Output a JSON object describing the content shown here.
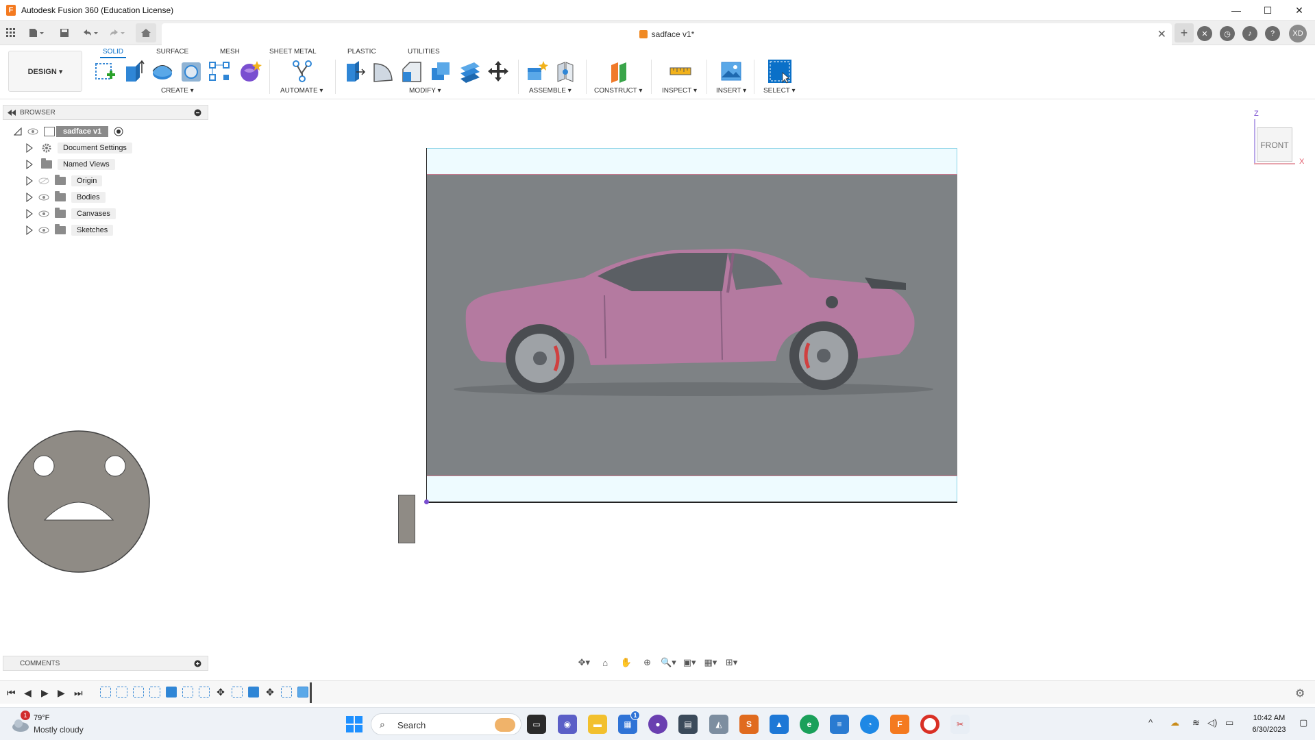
{
  "window": {
    "title": "Autodesk Fusion 360 (Education License)",
    "minimize": "—",
    "maximize": "☐",
    "close": "✕"
  },
  "document": {
    "tab_title": "sadface v1*",
    "close": "✕"
  },
  "user": {
    "initials": "XD"
  },
  "ribbon": {
    "workspace": "DESIGN ▾",
    "tabs": [
      "SOLID",
      "SURFACE",
      "MESH",
      "SHEET METAL",
      "PLASTIC",
      "UTILITIES"
    ],
    "groups": {
      "create": "CREATE ▾",
      "automate": "AUTOMATE ▾",
      "modify": "MODIFY ▾",
      "assemble": "ASSEMBLE ▾",
      "construct": "CONSTRUCT ▾",
      "inspect": "INSPECT ▾",
      "insert": "INSERT ▾",
      "select": "SELECT ▾"
    }
  },
  "browser": {
    "header": "BROWSER",
    "root": "sadface v1",
    "items": [
      {
        "label": "Document Settings",
        "icon": "gear-icon"
      },
      {
        "label": "Named Views",
        "icon": "folder-icon"
      },
      {
        "label": "Origin",
        "icon": "folder-icon",
        "hidden": true
      },
      {
        "label": "Bodies",
        "icon": "folder-icon"
      },
      {
        "label": "Canvases",
        "icon": "folder-icon"
      },
      {
        "label": "Sketches",
        "icon": "folder-icon"
      }
    ]
  },
  "viewcube": {
    "face": "FRONT",
    "axis_z": "Z",
    "axis_x": "X"
  },
  "comments": {
    "header": "COMMENTS"
  },
  "taskbar": {
    "weather_temp": "79°F",
    "weather_desc": "Mostly cloudy",
    "weather_badge": "1",
    "search_placeholder": "Search",
    "store_badge": "1",
    "time": "10:42 AM",
    "date": "6/30/2023"
  },
  "colors": {
    "accent": "#0a70c8",
    "canvas_gray": "#7e8285",
    "car_pink": "#b47aa0",
    "sadface_fill": "#8f8b85",
    "fusion_orange": "#f47a20"
  }
}
